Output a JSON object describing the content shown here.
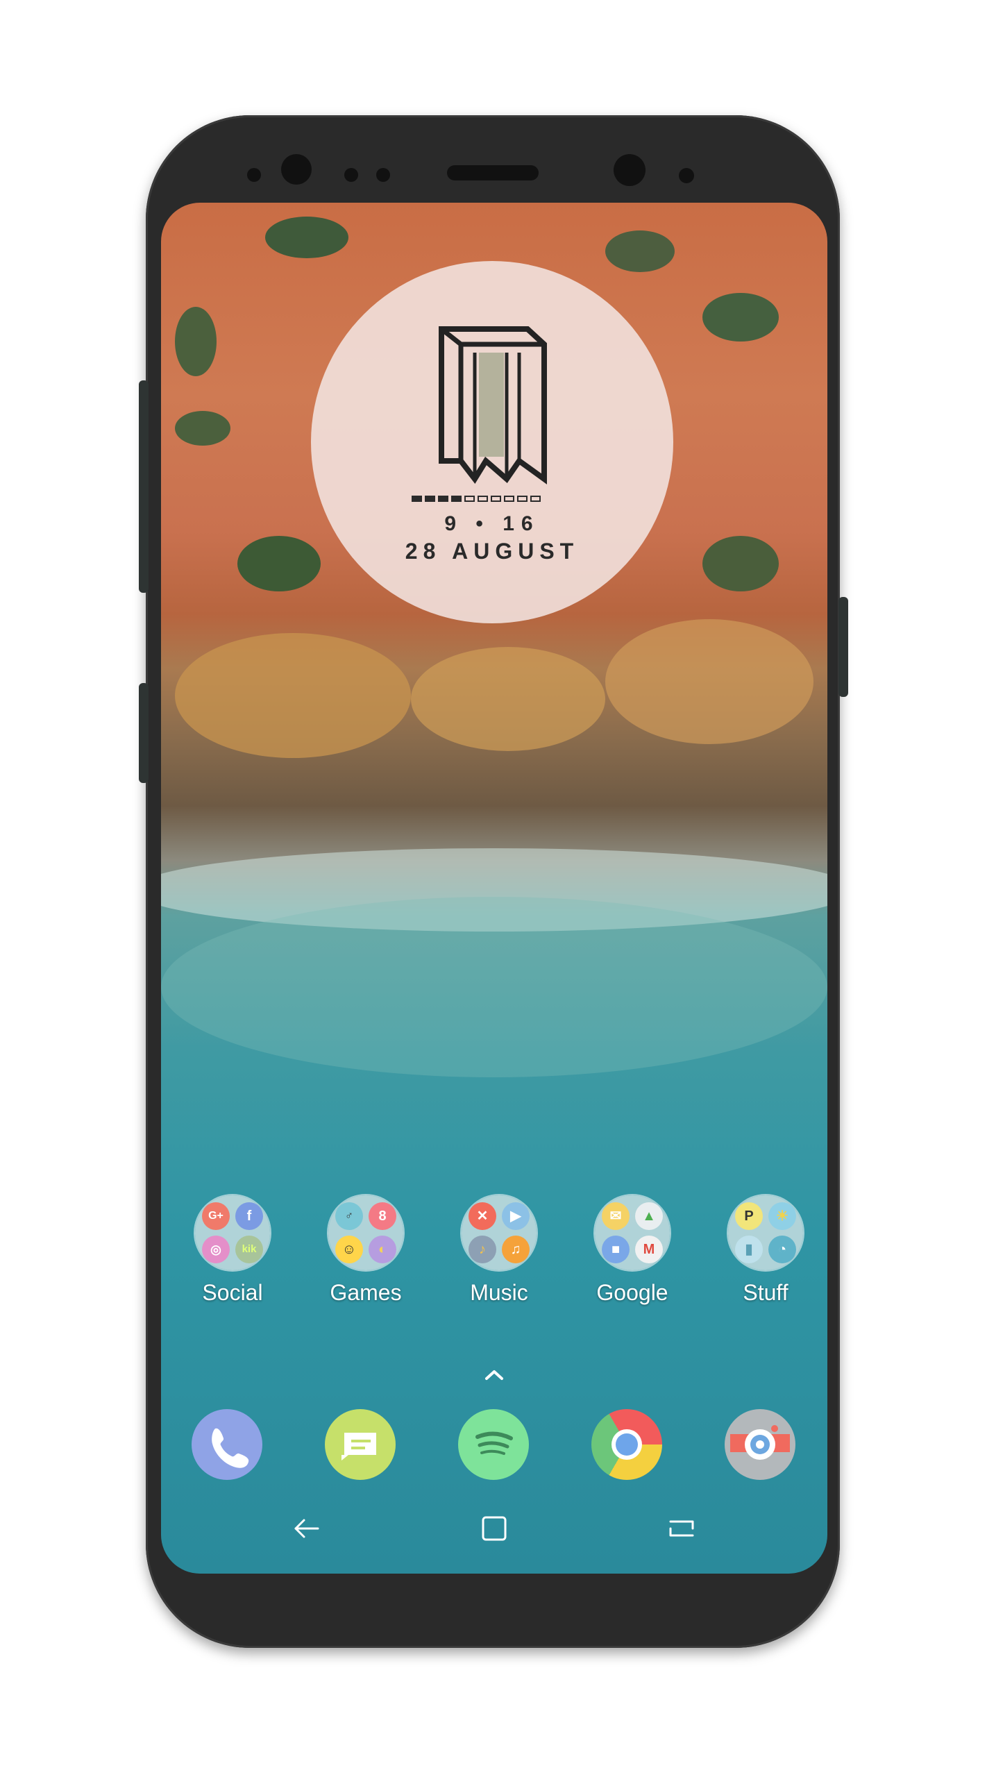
{
  "widget": {
    "time": "9 • 16",
    "date": "28  AUGUST",
    "battery_segments_filled": 4,
    "battery_segments_total": 10
  },
  "folders": [
    {
      "label": "Social",
      "icons": [
        "google-plus-icon",
        "facebook-icon",
        "instagram-icon",
        "kik-icon"
      ]
    },
    {
      "label": "Games",
      "icons": [
        "game-icon",
        "8-ball-icon",
        "emoji-game-icon",
        "game-icon"
      ]
    },
    {
      "label": "Music",
      "icons": [
        "music-x-icon",
        "play-icon",
        "music-icon",
        "music-note-icon"
      ]
    },
    {
      "label": "Google",
      "icons": [
        "gmail-icon",
        "drive-icon",
        "duo-icon",
        "gmail-icon"
      ]
    },
    {
      "label": "Stuff",
      "icons": [
        "pushbullet-icon",
        "weather-icon",
        "app-icon",
        "speedometer-icon"
      ]
    }
  ],
  "dock": [
    "phone-icon",
    "messages-icon",
    "spotify-icon",
    "chrome-icon",
    "camera-icon"
  ],
  "nav": [
    "back-icon",
    "home-icon",
    "recents-icon"
  ]
}
